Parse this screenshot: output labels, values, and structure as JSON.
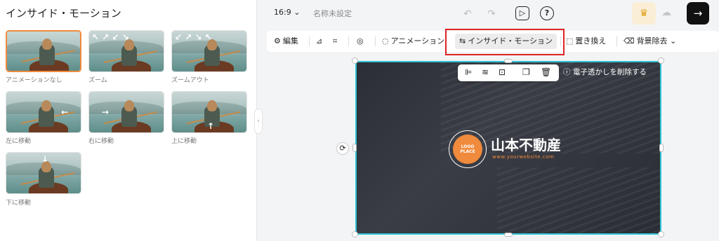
{
  "left_panel": {
    "title": "インサイド・モーション",
    "motions": [
      {
        "label": "アニメーションなし",
        "arrows": ""
      },
      {
        "label": "ズーム",
        "arrows": "↖ ↗ ↙ ↘"
      },
      {
        "label": "ズームアウト",
        "arrows": "↙ ↗ ↘ ↖"
      },
      {
        "label": "左に移動",
        "arrows": "←"
      },
      {
        "label": "右に移動",
        "arrows": "→"
      },
      {
        "label": "上に移動",
        "arrows": "↑"
      },
      {
        "label": "下に移動",
        "arrows": "↓"
      }
    ],
    "selected_index": 0
  },
  "topbar": {
    "ratio": "16:9 ⌄",
    "title": "名称未設定",
    "undo": "↶",
    "redo": "↷",
    "preview": "▷",
    "help": "?",
    "crown": "♛",
    "cloud": "☁",
    "next": "→"
  },
  "toolbar": {
    "edit": "編集",
    "edit_icon": "⚙",
    "flip_icon": "⊿",
    "crop_icon": "⌗",
    "mask_icon": "◎",
    "animation": "アニメーション",
    "animation_icon": "◌",
    "inside_motion": "インサイド・モーション",
    "inside_motion_icon": "⇆",
    "replace": "置き換え",
    "replace_icon": "⬚",
    "remove_bg": "背景除去",
    "remove_bg_icon": "⌫",
    "remove_bg_chevron": "⌄"
  },
  "float_bar": {
    "align_icon": "⊫",
    "layer_icon": "≋",
    "lock_icon": "⊡",
    "copy_icon": "❐",
    "delete_icon": "🗑"
  },
  "watermark": {
    "icon": "ⓘ",
    "text": "電子透かしを削除する"
  },
  "canvas": {
    "logo_line1": "LOGO",
    "logo_line2": "PLACE",
    "brand": "山本不動産",
    "url": "www.yourwebsite.com",
    "rotate_icon": "⟳"
  },
  "colors": {
    "accent_orange": "#f08a3c",
    "selection": "#2fc4d6",
    "highlight": "#e02424"
  }
}
